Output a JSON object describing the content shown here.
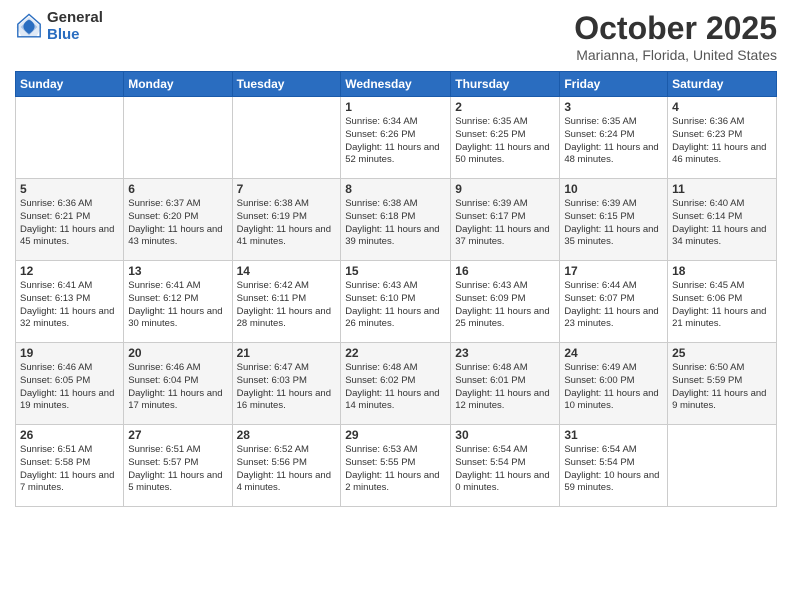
{
  "header": {
    "logo_general": "General",
    "logo_blue": "Blue",
    "month_title": "October 2025",
    "location": "Marianna, Florida, United States"
  },
  "days_of_week": [
    "Sunday",
    "Monday",
    "Tuesday",
    "Wednesday",
    "Thursday",
    "Friday",
    "Saturday"
  ],
  "weeks": [
    [
      {
        "day": "",
        "info": ""
      },
      {
        "day": "",
        "info": ""
      },
      {
        "day": "",
        "info": ""
      },
      {
        "day": "1",
        "info": "Sunrise: 6:34 AM\nSunset: 6:26 PM\nDaylight: 11 hours and 52 minutes."
      },
      {
        "day": "2",
        "info": "Sunrise: 6:35 AM\nSunset: 6:25 PM\nDaylight: 11 hours and 50 minutes."
      },
      {
        "day": "3",
        "info": "Sunrise: 6:35 AM\nSunset: 6:24 PM\nDaylight: 11 hours and 48 minutes."
      },
      {
        "day": "4",
        "info": "Sunrise: 6:36 AM\nSunset: 6:23 PM\nDaylight: 11 hours and 46 minutes."
      }
    ],
    [
      {
        "day": "5",
        "info": "Sunrise: 6:36 AM\nSunset: 6:21 PM\nDaylight: 11 hours and 45 minutes."
      },
      {
        "day": "6",
        "info": "Sunrise: 6:37 AM\nSunset: 6:20 PM\nDaylight: 11 hours and 43 minutes."
      },
      {
        "day": "7",
        "info": "Sunrise: 6:38 AM\nSunset: 6:19 PM\nDaylight: 11 hours and 41 minutes."
      },
      {
        "day": "8",
        "info": "Sunrise: 6:38 AM\nSunset: 6:18 PM\nDaylight: 11 hours and 39 minutes."
      },
      {
        "day": "9",
        "info": "Sunrise: 6:39 AM\nSunset: 6:17 PM\nDaylight: 11 hours and 37 minutes."
      },
      {
        "day": "10",
        "info": "Sunrise: 6:39 AM\nSunset: 6:15 PM\nDaylight: 11 hours and 35 minutes."
      },
      {
        "day": "11",
        "info": "Sunrise: 6:40 AM\nSunset: 6:14 PM\nDaylight: 11 hours and 34 minutes."
      }
    ],
    [
      {
        "day": "12",
        "info": "Sunrise: 6:41 AM\nSunset: 6:13 PM\nDaylight: 11 hours and 32 minutes."
      },
      {
        "day": "13",
        "info": "Sunrise: 6:41 AM\nSunset: 6:12 PM\nDaylight: 11 hours and 30 minutes."
      },
      {
        "day": "14",
        "info": "Sunrise: 6:42 AM\nSunset: 6:11 PM\nDaylight: 11 hours and 28 minutes."
      },
      {
        "day": "15",
        "info": "Sunrise: 6:43 AM\nSunset: 6:10 PM\nDaylight: 11 hours and 26 minutes."
      },
      {
        "day": "16",
        "info": "Sunrise: 6:43 AM\nSunset: 6:09 PM\nDaylight: 11 hours and 25 minutes."
      },
      {
        "day": "17",
        "info": "Sunrise: 6:44 AM\nSunset: 6:07 PM\nDaylight: 11 hours and 23 minutes."
      },
      {
        "day": "18",
        "info": "Sunrise: 6:45 AM\nSunset: 6:06 PM\nDaylight: 11 hours and 21 minutes."
      }
    ],
    [
      {
        "day": "19",
        "info": "Sunrise: 6:46 AM\nSunset: 6:05 PM\nDaylight: 11 hours and 19 minutes."
      },
      {
        "day": "20",
        "info": "Sunrise: 6:46 AM\nSunset: 6:04 PM\nDaylight: 11 hours and 17 minutes."
      },
      {
        "day": "21",
        "info": "Sunrise: 6:47 AM\nSunset: 6:03 PM\nDaylight: 11 hours and 16 minutes."
      },
      {
        "day": "22",
        "info": "Sunrise: 6:48 AM\nSunset: 6:02 PM\nDaylight: 11 hours and 14 minutes."
      },
      {
        "day": "23",
        "info": "Sunrise: 6:48 AM\nSunset: 6:01 PM\nDaylight: 11 hours and 12 minutes."
      },
      {
        "day": "24",
        "info": "Sunrise: 6:49 AM\nSunset: 6:00 PM\nDaylight: 11 hours and 10 minutes."
      },
      {
        "day": "25",
        "info": "Sunrise: 6:50 AM\nSunset: 5:59 PM\nDaylight: 11 hours and 9 minutes."
      }
    ],
    [
      {
        "day": "26",
        "info": "Sunrise: 6:51 AM\nSunset: 5:58 PM\nDaylight: 11 hours and 7 minutes."
      },
      {
        "day": "27",
        "info": "Sunrise: 6:51 AM\nSunset: 5:57 PM\nDaylight: 11 hours and 5 minutes."
      },
      {
        "day": "28",
        "info": "Sunrise: 6:52 AM\nSunset: 5:56 PM\nDaylight: 11 hours and 4 minutes."
      },
      {
        "day": "29",
        "info": "Sunrise: 6:53 AM\nSunset: 5:55 PM\nDaylight: 11 hours and 2 minutes."
      },
      {
        "day": "30",
        "info": "Sunrise: 6:54 AM\nSunset: 5:54 PM\nDaylight: 11 hours and 0 minutes."
      },
      {
        "day": "31",
        "info": "Sunrise: 6:54 AM\nSunset: 5:54 PM\nDaylight: 10 hours and 59 minutes."
      },
      {
        "day": "",
        "info": ""
      }
    ]
  ]
}
